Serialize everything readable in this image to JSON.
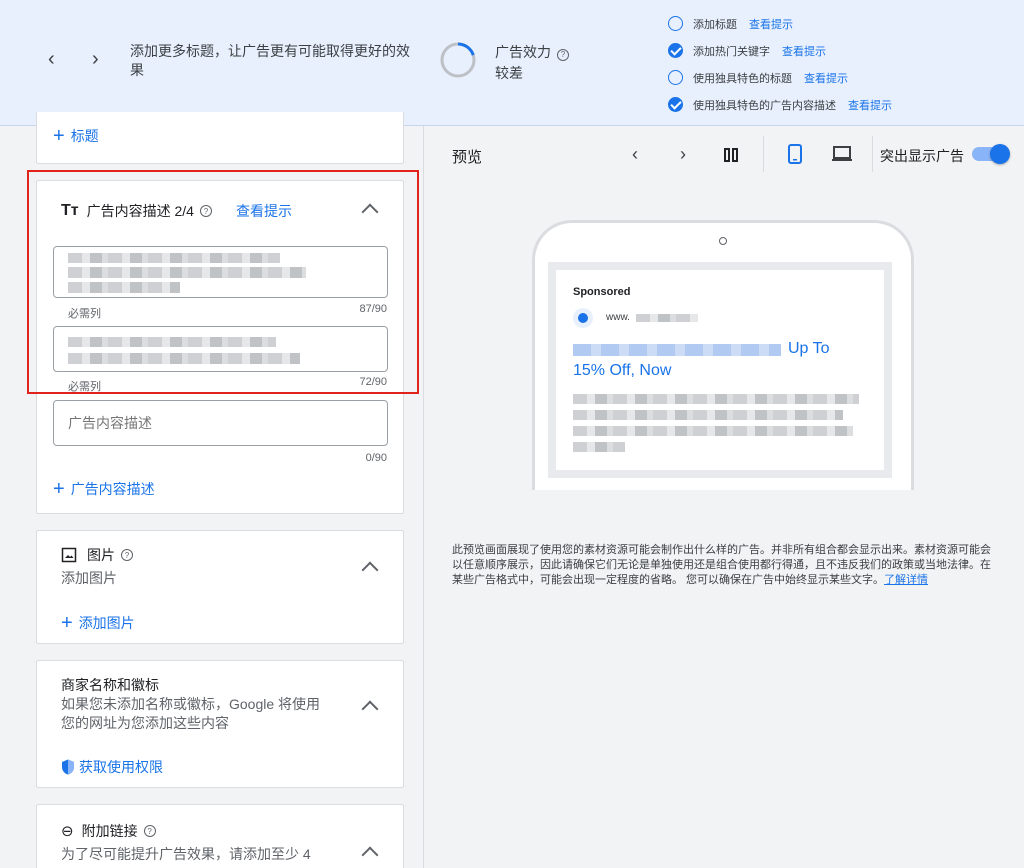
{
  "banner": {
    "tip": "添加更多标题，让广告更有可能取得更好的效果",
    "effectiveness_label": "广告效力",
    "effectiveness_value": "较差",
    "checklist": [
      {
        "label": "添加标题",
        "link": "查看提示",
        "done": false
      },
      {
        "label": "添加热门关键字",
        "link": "查看提示",
        "done": true
      },
      {
        "label": "使用独具特色的标题",
        "link": "查看提示",
        "done": false
      },
      {
        "label": "使用独具特色的广告内容描述",
        "link": "查看提示",
        "done": true
      }
    ]
  },
  "headlines": {
    "add_label": "标题"
  },
  "descriptions": {
    "title": "广告内容描述 2/4",
    "tips_link": "查看提示",
    "fields": [
      {
        "required": "必需列",
        "count": "87/90"
      },
      {
        "required": "必需列",
        "count": "72/90"
      },
      {
        "placeholder": "广告内容描述",
        "count": "0/90"
      }
    ],
    "add_label": "广告内容描述"
  },
  "images": {
    "title": "图片",
    "subtitle": "添加图片",
    "add_label": "添加图片"
  },
  "business": {
    "title": "商家名称和徽标",
    "subtitle": "如果您未添加名称或徽标，Google 将使用您的网址为您添加这些内容",
    "access_label": "获取使用权限"
  },
  "sitelinks": {
    "title": "附加链接",
    "subtitle": "为了尽可能提升广告效果，请添加至少 4"
  },
  "preview": {
    "title": "预览",
    "highlight_label": "突出显示广告",
    "ad": {
      "sponsored": "Sponsored",
      "url_prefix": "www.",
      "headline_tail": "Up To",
      "headline_line2": "15% Off, Now"
    },
    "disclaimer": "此预览画面展现了使用您的素材资源可能会制作出什么样的广告。并非所有组合都会显示出来。素材资源可能会以任意顺序展示，因此请确保它们无论是单独使用还是组合使用都行得通，且不违反我们的政策或当地法律。在某些广告格式中，可能会出现一定程度的省略。 您可以确保在广告中始终显示某些文字。",
    "learn_more": "了解详情"
  },
  "colors": {
    "accent": "#1a73e8",
    "highlight": "#e0241b",
    "banner_bg": "#e8f0fe"
  },
  "effectiveness_progress": 0.2
}
